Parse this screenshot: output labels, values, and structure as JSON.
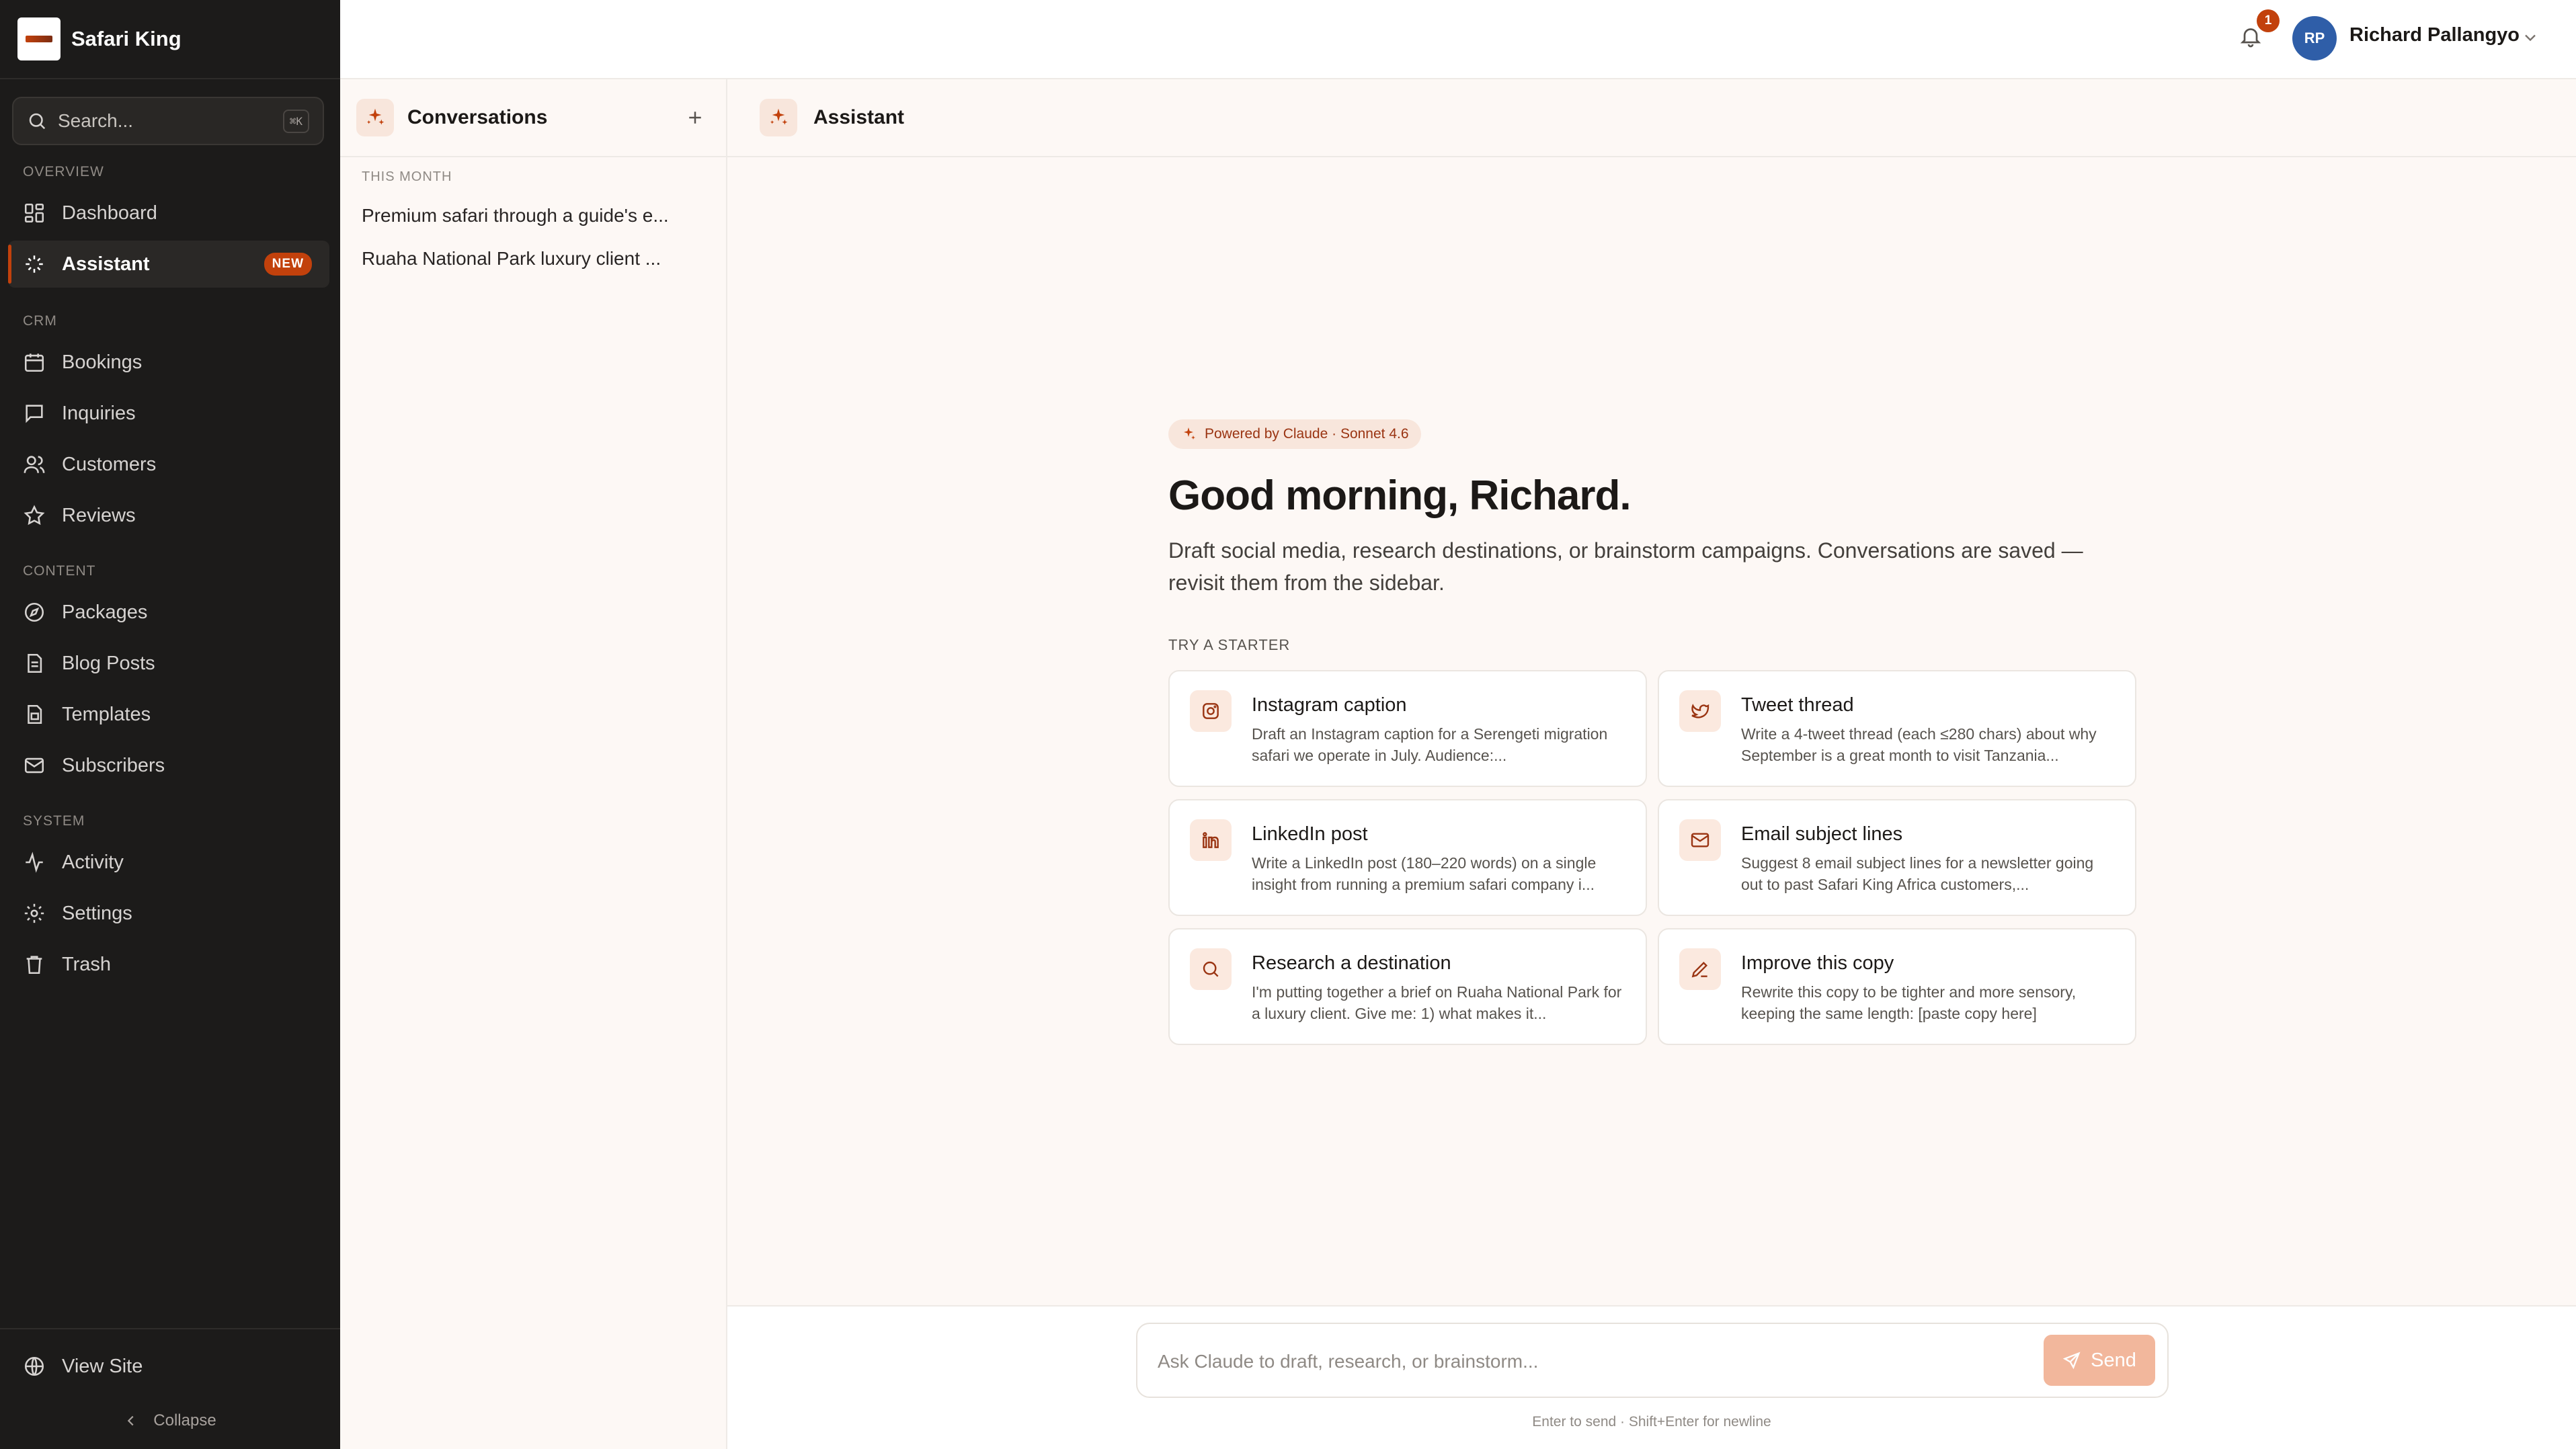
{
  "brand": {
    "name": "Safari King"
  },
  "search": {
    "placeholder": "Search...",
    "shortcut": "⌘K"
  },
  "sidebar": {
    "sections": [
      {
        "label": "Overview"
      },
      {
        "label": "CRM"
      },
      {
        "label": "Content"
      },
      {
        "label": "System"
      }
    ],
    "items": [
      {
        "label": "Dashboard",
        "icon": "grid-icon"
      },
      {
        "label": "Assistant",
        "icon": "sparkle-icon",
        "badge": "NEW",
        "active": true
      },
      {
        "label": "Bookings",
        "icon": "calendar-icon"
      },
      {
        "label": "Inquiries",
        "icon": "message-icon"
      },
      {
        "label": "Customers",
        "icon": "users-icon"
      },
      {
        "label": "Reviews",
        "icon": "star-icon"
      },
      {
        "label": "Packages",
        "icon": "compass-icon"
      },
      {
        "label": "Blog Posts",
        "icon": "document-icon"
      },
      {
        "label": "Templates",
        "icon": "template-icon"
      },
      {
        "label": "Subscribers",
        "icon": "mail-icon"
      },
      {
        "label": "Activity",
        "icon": "activity-icon"
      },
      {
        "label": "Settings",
        "icon": "gear-icon"
      },
      {
        "label": "Trash",
        "icon": "trash-icon"
      }
    ],
    "view_site": "View Site",
    "collapse": "Collapse"
  },
  "topbar": {
    "notification_count": "1",
    "user_initials": "RP",
    "user_name": "Richard Pallangyo"
  },
  "conversations": {
    "title": "Conversations",
    "group_label": "This month",
    "items": [
      "Premium safari through a guide's e...",
      "Ruaha National Park luxury client ..."
    ]
  },
  "assistant": {
    "title": "Assistant",
    "powered_by": "Powered by Claude · Sonnet 4.6",
    "greeting": "Good morning, Richard.",
    "subtitle": "Draft social media, research destinations, or brainstorm campaigns. Conversations are saved — revisit them from the sidebar.",
    "starter_label": "Try a starter",
    "starters": [
      {
        "title": "Instagram caption",
        "desc": "Draft an Instagram caption for a Serengeti migration safari we operate in July. Audience:...",
        "icon": "instagram-icon"
      },
      {
        "title": "Tweet thread",
        "desc": "Write a 4-tweet thread (each ≤280 chars) about why September is a great month to visit Tanzania...",
        "icon": "twitter-icon"
      },
      {
        "title": "LinkedIn post",
        "desc": "Write a LinkedIn post (180–220 words) on a single insight from running a premium safari company i...",
        "icon": "linkedin-icon"
      },
      {
        "title": "Email subject lines",
        "desc": "Suggest 8 email subject lines for a newsletter going out to past Safari King Africa customers,...",
        "icon": "mail-icon"
      },
      {
        "title": "Research a destination",
        "desc": "I'm putting together a brief on Ruaha National Park for a luxury client. Give me: 1) what makes it...",
        "icon": "search-icon"
      },
      {
        "title": "Improve this copy",
        "desc": "Rewrite this copy to be tighter and more sensory, keeping the same length: [paste copy here]",
        "icon": "pencil-icon"
      }
    ],
    "composer_placeholder": "Ask Claude to draft, research, or brainstorm...",
    "send_label": "Send",
    "hint": "Enter to send · Shift+Enter for newline"
  },
  "colors": {
    "accent": "#c2410c",
    "sidebar_bg": "#1c1b1a",
    "main_bg": "#fdf8f5"
  }
}
